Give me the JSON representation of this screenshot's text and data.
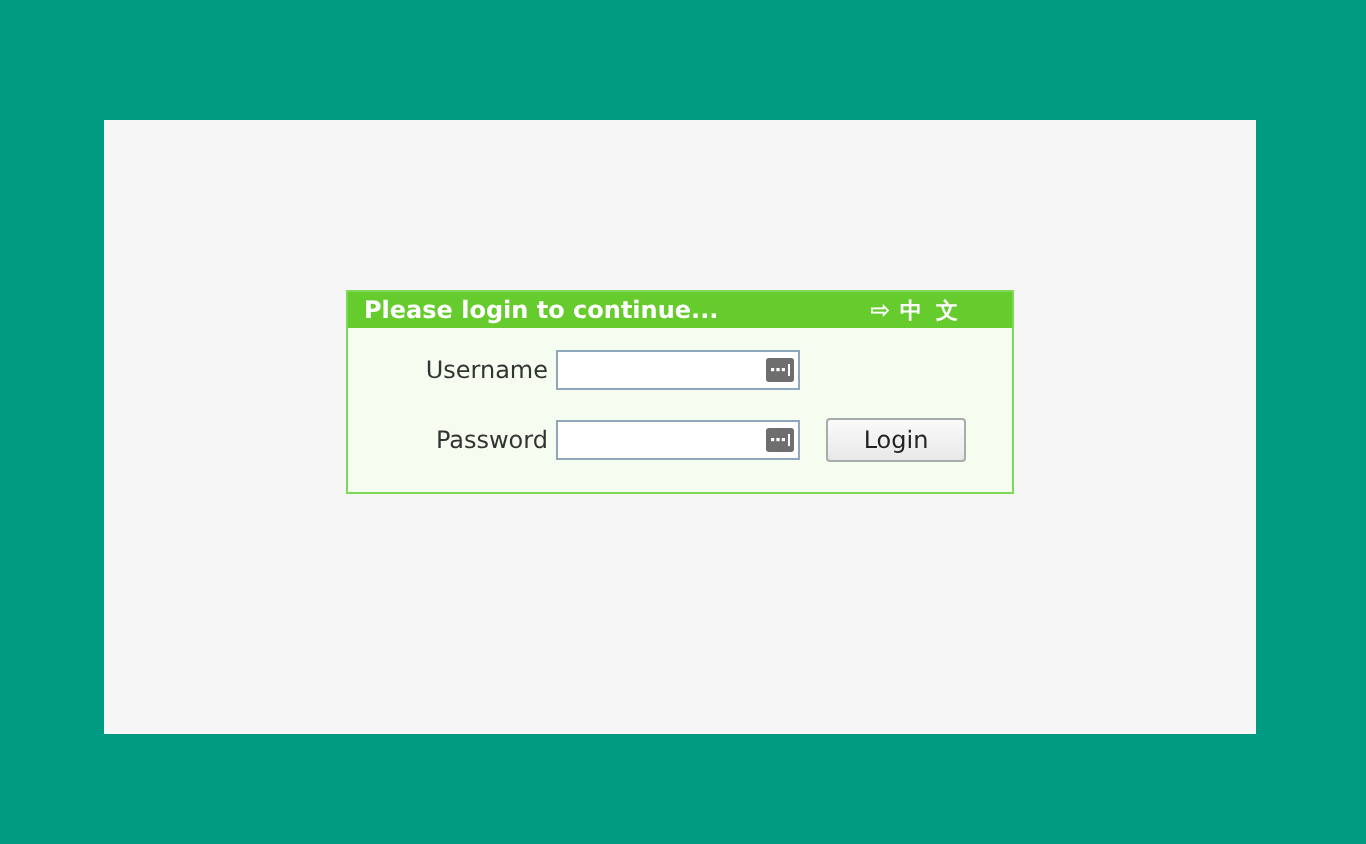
{
  "login_box": {
    "title": "Please login to continue...",
    "language_arrow": "⇨",
    "language_link": "中 文"
  },
  "fields": [
    {
      "label": "Username"
    },
    {
      "label": "Password"
    }
  ],
  "buttons": [
    "Login"
  ]
}
